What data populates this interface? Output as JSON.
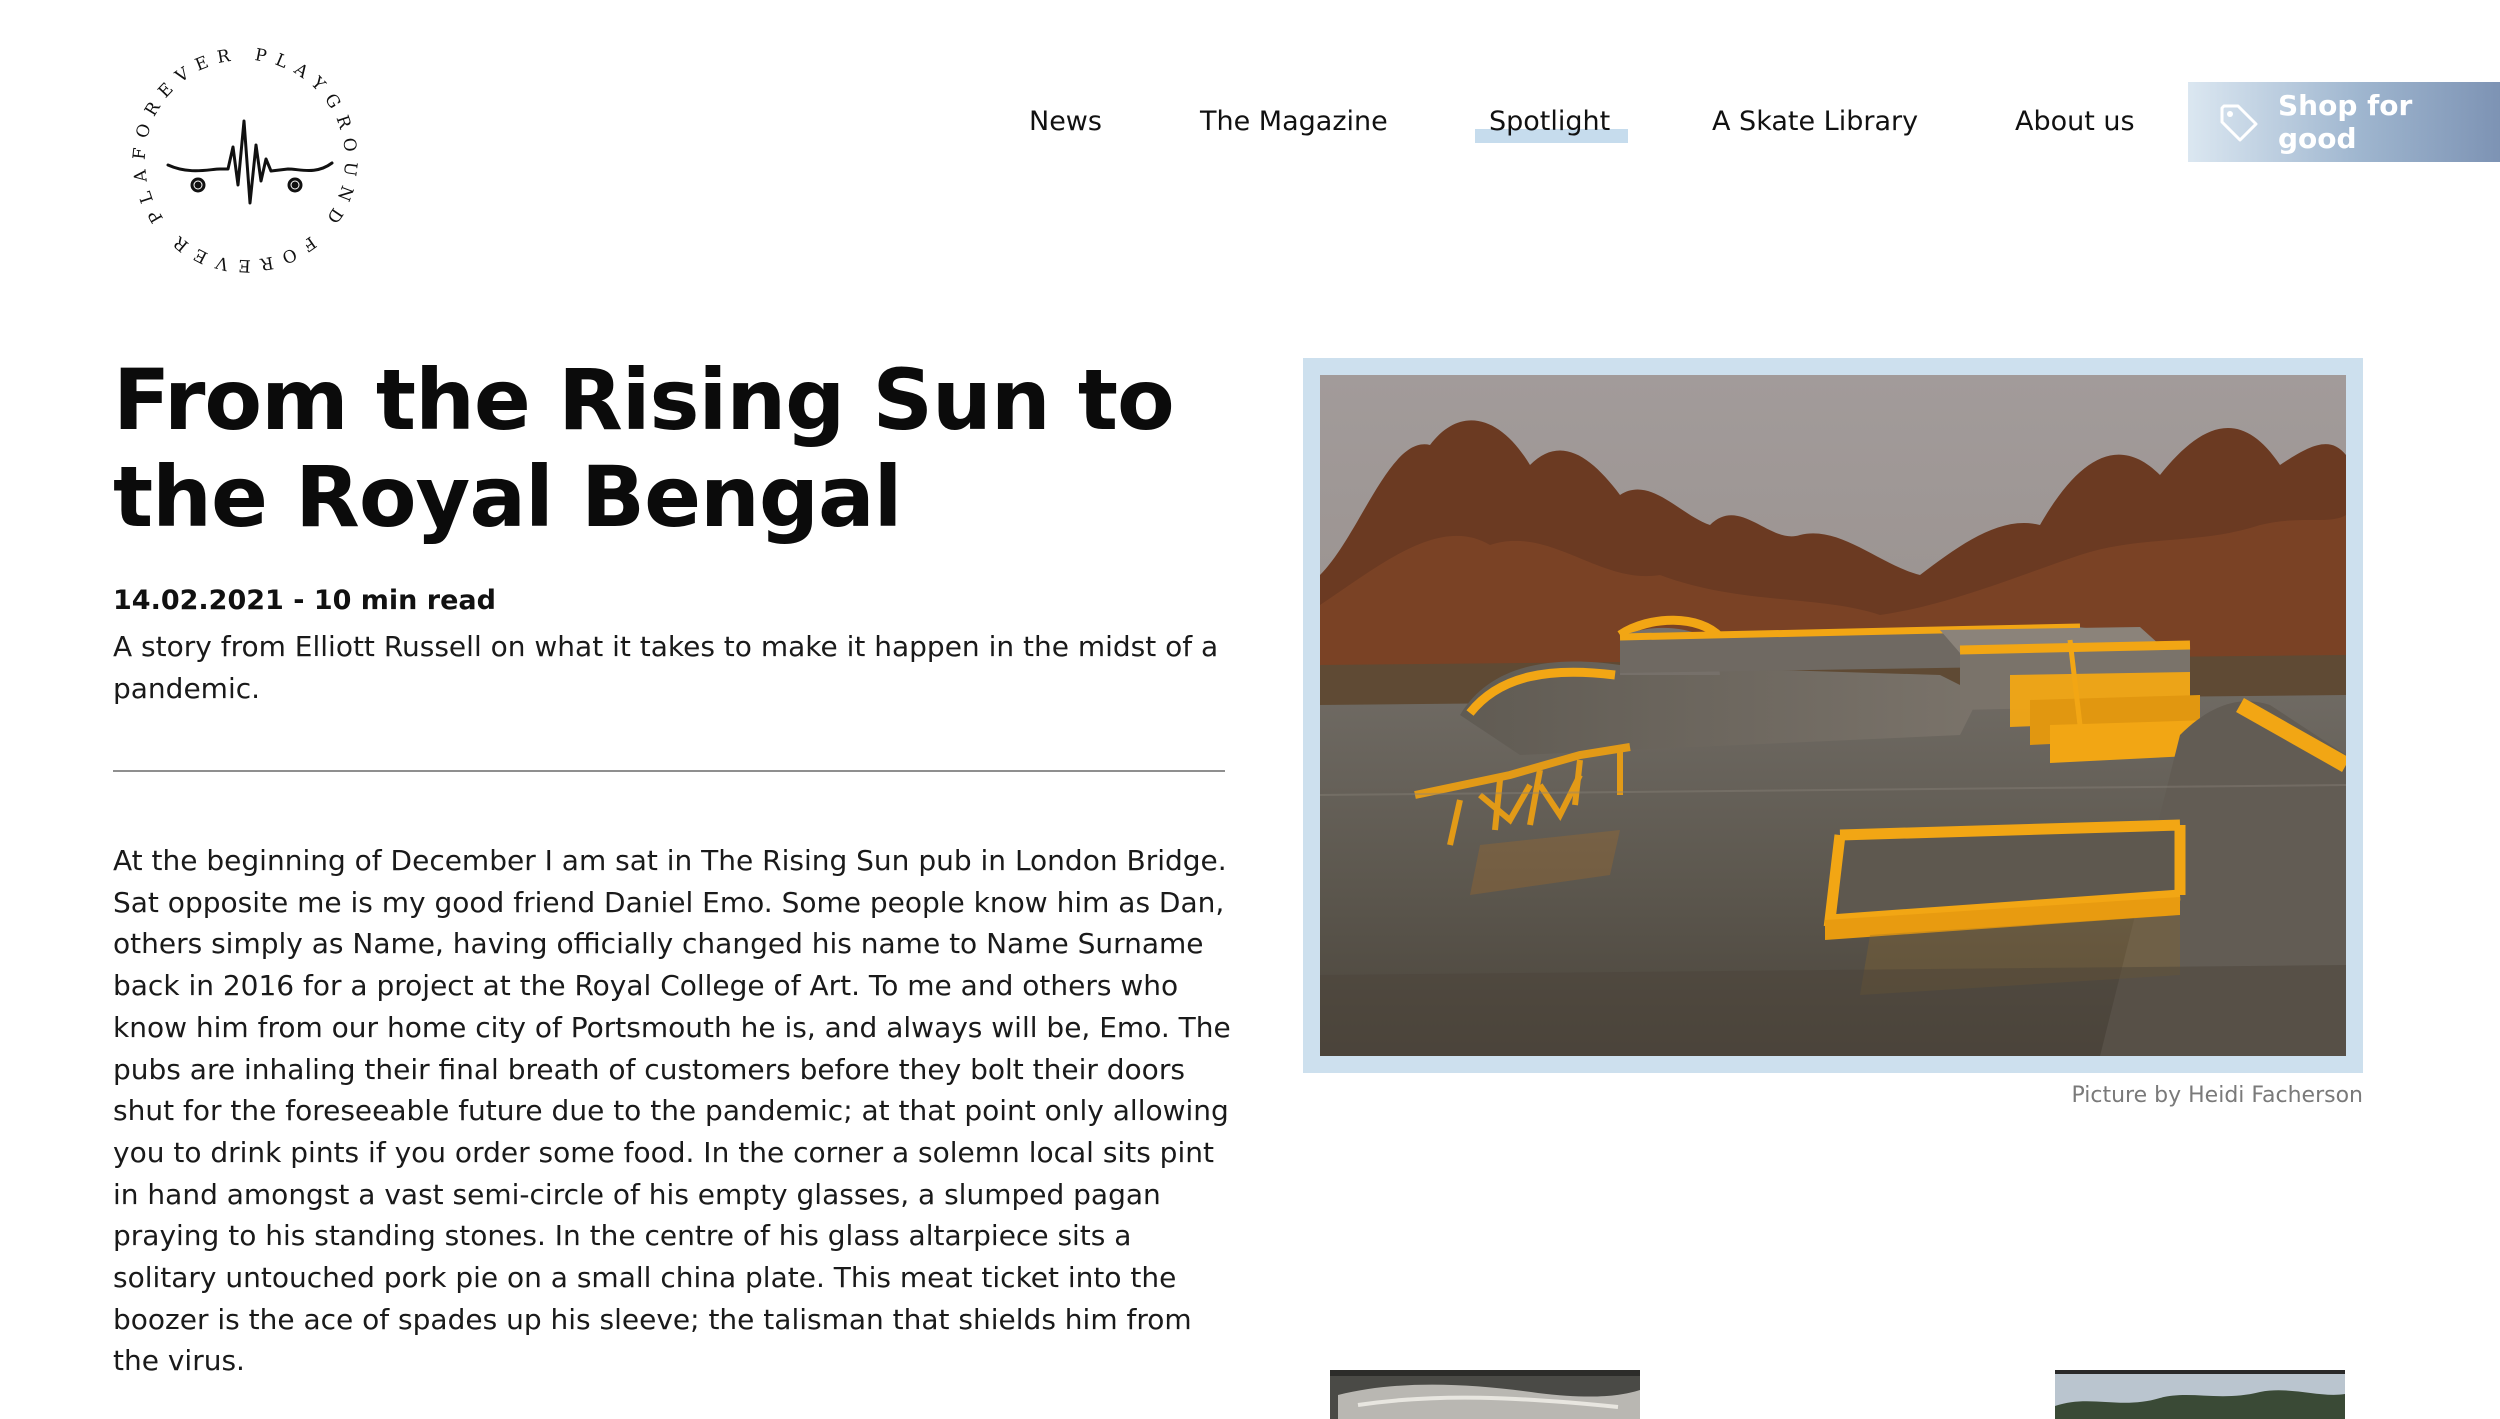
{
  "logo": {
    "ring_text": "FOREVER PLAYGROUND FOREVER PLAYGROUND",
    "icon": "heartbeat-skateboard-icon"
  },
  "nav": {
    "items": [
      {
        "label": "News"
      },
      {
        "label": "The Magazine"
      },
      {
        "label": "Spotlight",
        "active": true
      },
      {
        "label": "A Skate Library"
      },
      {
        "label": "About us"
      }
    ],
    "shop_button": {
      "label": "Shop for good",
      "icon": "tag-icon"
    }
  },
  "article": {
    "title": "From the Rising Sun to the Royal Bengal",
    "meta": "14.02.2021 - 10 min read",
    "subtitle": "A story from Elliott Russell on what it takes to make it happen in the midst of a pandemic.",
    "body": "At the beginning of December I am sat in The Rising Sun pub in London Bridge. Sat opposite me is my good friend Daniel Emo. Some people know him as Dan, others simply as Name, having officially changed his name to Name Surname back in 2016 for a project at the Royal College of Art. To me and others who know him from our home city of Portsmouth he is, and always will be, Emo. The pubs are inhaling their final breath of customers before they bolt their doors shut for the foreseeable future due to the pandemic; at that point only allowing you to drink pints if you order some food. In the corner a solemn local sits pint in hand amongst a vast semi-circle of his empty glasses, a slumped pagan praying to his standing stones. In the centre of his glass altarpiece sits a solitary untouched pork pie on a small china plate. This meat ticket into the boozer is the ace of spades up his sleeve; the talisman that shields him from the virus."
  },
  "hero": {
    "caption": "Picture by Heidi Facherson"
  },
  "colors": {
    "accent_highlight": "#c6dced",
    "frame": "#cde0ee",
    "shop_gradient_start": "#dbe7f1",
    "shop_gradient_end": "#7d93b4",
    "skatepark_yellow": "#f2a614"
  }
}
